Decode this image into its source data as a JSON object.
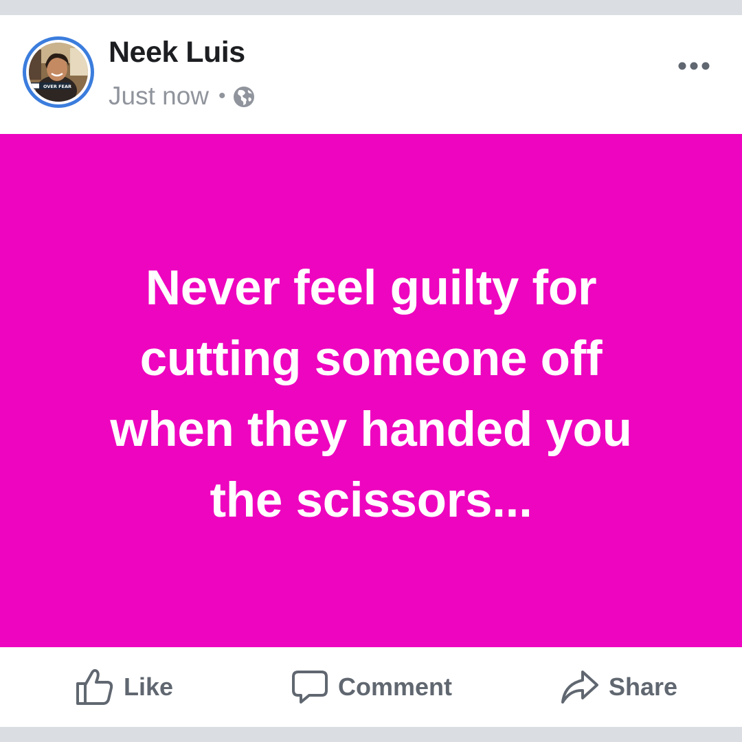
{
  "post": {
    "author": "Neek Luis",
    "timestamp": "Just now",
    "separator": "•",
    "privacy_icon": "globe-icon",
    "more_icon": "more-options-icon",
    "background_color": "#ee05bf",
    "text": "Never feel guilty for cutting someone off when they handed you the scissors..."
  },
  "avatar": {
    "ring_color": "#3b7ddd",
    "caption_text": "OVER FEAR"
  },
  "actions": {
    "like_label": "Like",
    "like_icon": "thumbs-up-icon",
    "comment_label": "Comment",
    "comment_icon": "speech-bubble-icon",
    "share_label": "Share",
    "share_icon": "share-arrow-icon"
  },
  "colors": {
    "name_text": "#1c1e21",
    "meta_text": "#90949c",
    "action_text": "#606770",
    "page_background": "#dadde1"
  }
}
